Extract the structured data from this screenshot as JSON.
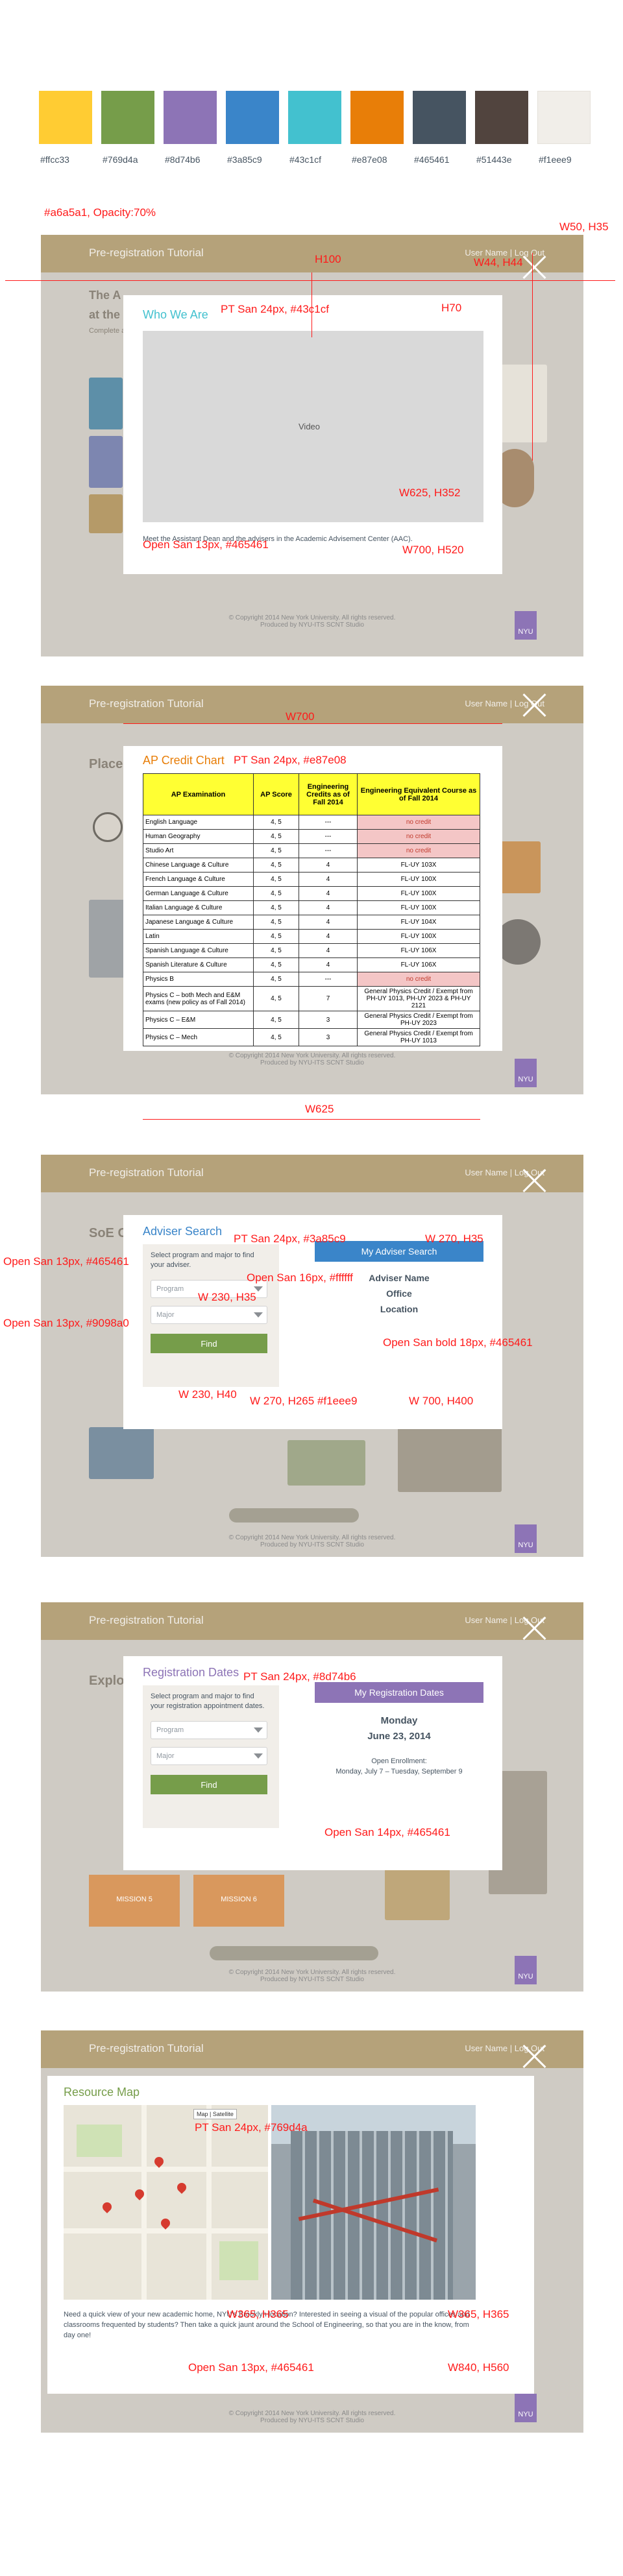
{
  "palette": [
    {
      "hex": "#ffcc33",
      "label": "#ffcc33"
    },
    {
      "hex": "#769d4a",
      "label": "#769d4a"
    },
    {
      "hex": "#8d74b6",
      "label": "#8d74b6"
    },
    {
      "hex": "#3a85c9",
      "label": "#3a85c9"
    },
    {
      "hex": "#43c1cf",
      "label": "#43c1cf"
    },
    {
      "hex": "#e87e08",
      "label": "#e87e08"
    },
    {
      "hex": "#465461",
      "label": "#465461"
    },
    {
      "hex": "#51443e",
      "label": "#51443e"
    },
    {
      "hex": "#f1eee9",
      "label": "#f1eee9"
    }
  ],
  "common": {
    "app_title": "Pre-registration Tutorial",
    "user_links": "User Name | Log Out",
    "footer_line1": "© Copyright 2014 New York University. All rights reserved.",
    "footer_line2": "Produced by NYU-ITS SCNT Studio",
    "nyu_logo": "NYU"
  },
  "s1": {
    "overlay_note": "#a6a5a1, Opacity:70%",
    "close_note": "W50, H35",
    "close_note2": "W44, H44",
    "h100": "H100",
    "h70": "H70",
    "title": "Who We Are",
    "title_note": "PT San 24px, #43c1cf",
    "video_label": "Video",
    "video_note": "W625, H352",
    "caption": "Meet the Assistant Dean and the advisers in the Academic Advisement Center (AAC).",
    "caption_note": "Open San 13px, #465461",
    "modal_note": "W700, H520",
    "bg_heading_1": "The A",
    "bg_heading_2": "at the",
    "bg_sub": "Complete a"
  },
  "s2": {
    "w700": "W700",
    "title": "AP Credit Chart",
    "title_note": "PT San 24px, #e87e08",
    "w625": "W625",
    "bg_heading": "Placem",
    "headers": [
      "AP Examination",
      "AP Score",
      "Engineering Credits as of Fall 2014",
      "Engineering Equivalent Course as of Fall 2014"
    ],
    "rows": [
      [
        "English Language",
        "4, 5",
        "---",
        "no credit"
      ],
      [
        "Human Geography",
        "4, 5",
        "---",
        "no credit"
      ],
      [
        "Studio Art",
        "4, 5",
        "---",
        "no credit"
      ],
      [
        "Chinese Language & Culture",
        "4, 5",
        "4",
        "FL-UY 103X"
      ],
      [
        "French Language & Culture",
        "4, 5",
        "4",
        "FL-UY 100X"
      ],
      [
        "German Language & Culture",
        "4, 5",
        "4",
        "FL-UY 100X"
      ],
      [
        "Italian Language & Culture",
        "4, 5",
        "4",
        "FL-UY 100X"
      ],
      [
        "Japanese Language & Culture",
        "4, 5",
        "4",
        "FL-UY 104X"
      ],
      [
        "Latin",
        "4, 5",
        "4",
        "FL-UY 100X"
      ],
      [
        "Spanish Language & Culture",
        "4, 5",
        "4",
        "FL-UY 106X"
      ],
      [
        "Spanish Literature & Culture",
        "4, 5",
        "4",
        "FL-UY 106X"
      ],
      [
        "Physics B",
        "4, 5",
        "---",
        "no credit"
      ],
      [
        "Physics C – both Mech and E&M exams (new policy as of Fall 2014)",
        "4, 5",
        "7",
        "General Physics Credit / Exempt from PH-UY 1013, PH-UY 2023 & PH-UY 2121"
      ],
      [
        "Physics C – E&M",
        "4, 5",
        "3",
        "General Physics Credit / Exempt from PH-UY 2023"
      ],
      [
        "Physics C – Mech",
        "4, 5",
        "3",
        "General Physics Credit / Exempt from PH-UY 1013"
      ]
    ]
  },
  "s3": {
    "title": "Adviser Search",
    "title_note": "PT San 24px, #3a85c9",
    "left_note": "Open San 13px, #465461",
    "select_note": "Open San 13px, #9098a0",
    "instructions": "Select program and major to find your adviser.",
    "program_placeholder": "Program",
    "major_placeholder": "Major",
    "find_label": "Find",
    "hdr_button": "My Adviser Search",
    "hdr_note": "W 270, H35",
    "hdr_font_note": "Open San 16px, #ffffff",
    "sel_note": "W 230, H35",
    "find_note": "W 230, H40",
    "panel_note": "W 270, H265 #f1eee9",
    "modal_note": "W 700, H400",
    "adviser_name": "Adviser Name",
    "office": "Office",
    "location": "Location",
    "bold_note": "Open San bold 18px, #465461",
    "bg_heading": "SoE Co"
  },
  "s4": {
    "title": "Registration Dates",
    "title_note": "PT San 24px, #8d74b6",
    "instructions": "Select program and major to find your registration appointment dates.",
    "program_placeholder": "Program",
    "major_placeholder": "Major",
    "find_label": "Find",
    "hdr_button": "My Registration Dates",
    "day": "Monday",
    "date": "June 23, 2014",
    "open_label": "Open Enrollment:",
    "open_range": "Monday, July 7 – Tuesday, September 9",
    "font_note": "Open San 14px, #465461",
    "bg_heading": "Explo",
    "mission5": "MISSION 5",
    "mission6": "MISSION 6"
  },
  "s5": {
    "title": "Resource Map",
    "title_note": "PT San 24px, #769d4a",
    "map_note": "W365, H365",
    "photo_note": "W365, H365",
    "desc": "Need a quick view of your new academic home, NYU's Brooklyn location? Interested in seeing a visual of the popular offices and classrooms frequented by students? Then take a quick jaunt around the School of Engineering, so that you are in the know, from day one!",
    "desc_note": "Open San 13px, #465461",
    "modal_note": "W840, H560",
    "map_tabs": [
      "Map",
      "Satellite"
    ]
  }
}
